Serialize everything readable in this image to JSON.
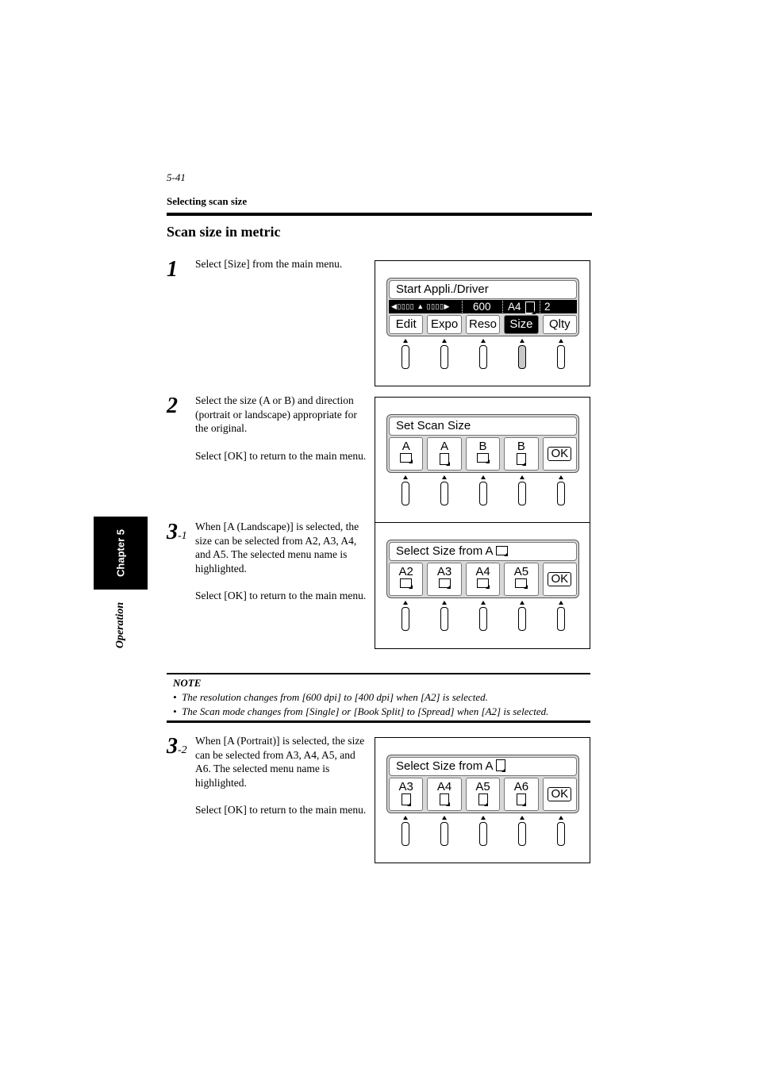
{
  "header": {
    "page_number": "5-41",
    "section": "Selecting scan size",
    "heading": "Scan size in metric"
  },
  "side_tab": {
    "chapter": "Chapter 5",
    "part": "Operation"
  },
  "steps": [
    {
      "number": "1",
      "suffix": "",
      "paragraphs": [
        "Select [Size] from the main menu."
      ]
    },
    {
      "number": "2",
      "suffix": "",
      "paragraphs": [
        "Select the size (A or B) and direction (portrait or landscape) appropriate for the original.",
        "Select [OK] to return to the main menu."
      ]
    },
    {
      "number": "3",
      "suffix": "-1",
      "paragraphs": [
        "When [A (Landscape)] is selected, the size can be selected from A2, A3, A4, and A5.  The selected menu name is highlighted.",
        "Select [OK] to return to the main menu."
      ]
    },
    {
      "number": "3",
      "suffix": "-2",
      "paragraphs": [
        "When [A (Portrait)] is selected, the size can be selected from A3, A4, A5, and A6. The selected menu name is highlighted.",
        "Select [OK] to return to the main menu."
      ]
    }
  ],
  "screens": {
    "main_menu": {
      "title": "Start Appli./Driver",
      "status": {
        "density_icon": "density-scale-icon",
        "resolution": "600",
        "size": "A4",
        "size_orientation": "portrait",
        "copies": "2"
      },
      "keys": [
        {
          "label": "Edit",
          "selected": false
        },
        {
          "label": "Expo",
          "selected": false
        },
        {
          "label": "Reso",
          "selected": false
        },
        {
          "label": "Size",
          "selected": true
        },
        {
          "label": "Qlty",
          "selected": false
        }
      ],
      "pressed_button_index": 3
    },
    "set_scan_size": {
      "title": "Set Scan Size",
      "keys": [
        {
          "label": "A",
          "orientation": "landscape"
        },
        {
          "label": "A",
          "orientation": "portrait"
        },
        {
          "label": "B",
          "orientation": "landscape"
        },
        {
          "label": "B",
          "orientation": "portrait"
        }
      ],
      "ok": "OK"
    },
    "select_a_landscape": {
      "title": "Select Size from A",
      "title_orientation": "landscape",
      "keys": [
        {
          "label": "A2",
          "orientation": "landscape"
        },
        {
          "label": "A3",
          "orientation": "landscape"
        },
        {
          "label": "A4",
          "orientation": "landscape"
        },
        {
          "label": "A5",
          "orientation": "landscape"
        }
      ],
      "ok": "OK"
    },
    "select_a_portrait": {
      "title": "Select Size from A",
      "title_orientation": "portrait",
      "keys": [
        {
          "label": "A3",
          "orientation": "portrait"
        },
        {
          "label": "A4",
          "orientation": "portrait"
        },
        {
          "label": "A5",
          "orientation": "portrait"
        },
        {
          "label": "A6",
          "orientation": "portrait"
        }
      ],
      "ok": "OK"
    }
  },
  "note": {
    "title": "NOTE",
    "items": [
      "The resolution changes from [600 dpi] to [400 dpi] when [A2] is selected.",
      "The Scan mode changes from [Single] or [Book Split] to [Spread] when [A2] is selected."
    ]
  }
}
